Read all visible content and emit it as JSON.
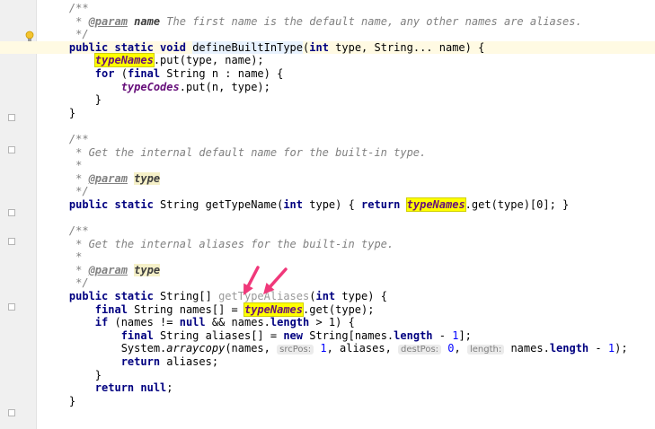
{
  "editor": {
    "lines": [
      [
        {
          "t": "    /**",
          "c": "c"
        }
      ],
      [
        {
          "t": "     * ",
          "c": "c"
        },
        {
          "t": "@param",
          "c": "tag"
        },
        {
          "t": " ",
          "c": "c"
        },
        {
          "t": "name",
          "c": "pname"
        },
        {
          "t": " The first name is the default name, any other names are aliases.",
          "c": "c"
        }
      ],
      [
        {
          "t": "     */",
          "c": "c"
        }
      ],
      [
        {
          "t": "    "
        },
        {
          "t": "public static void",
          "c": "k"
        },
        {
          "t": " "
        },
        {
          "t": "defineBuiltInType",
          "c": "m"
        },
        {
          "t": "("
        },
        {
          "t": "int",
          "c": "k"
        },
        {
          "t": " type, String... name) {"
        }
      ],
      [
        {
          "t": "        "
        },
        {
          "t": "typeNames",
          "c": "fld hl"
        },
        {
          "t": ".put(type, name);"
        }
      ],
      [
        {
          "t": "        "
        },
        {
          "t": "for",
          "c": "k"
        },
        {
          "t": " ("
        },
        {
          "t": "final",
          "c": "k"
        },
        {
          "t": " String n : name) {"
        }
      ],
      [
        {
          "t": "            "
        },
        {
          "t": "typeCodes",
          "c": "fld"
        },
        {
          "t": ".put(n, type);"
        }
      ],
      [
        {
          "t": "        }"
        }
      ],
      [
        {
          "t": "    }"
        }
      ],
      [
        {
          "t": ""
        }
      ],
      [
        {
          "t": "    /**",
          "c": "c"
        }
      ],
      [
        {
          "t": "     * Get the internal default name for the built-in type.",
          "c": "c"
        }
      ],
      [
        {
          "t": "     *",
          "c": "c"
        }
      ],
      [
        {
          "t": "     * ",
          "c": "c"
        },
        {
          "t": "@param",
          "c": "tag"
        },
        {
          "t": " ",
          "c": "c"
        },
        {
          "t": "type",
          "c": "pn"
        }
      ],
      [
        {
          "t": "     */",
          "c": "c"
        }
      ],
      [
        {
          "t": "    "
        },
        {
          "t": "public static",
          "c": "k"
        },
        {
          "t": " String getTypeName("
        },
        {
          "t": "int",
          "c": "k"
        },
        {
          "t": " type) { "
        },
        {
          "t": "return",
          "c": "k"
        },
        {
          "t": " "
        },
        {
          "t": "typeNames",
          "c": "fld hl"
        },
        {
          "t": ".get(type)[0]; }"
        }
      ],
      [
        {
          "t": ""
        }
      ],
      [
        {
          "t": "    /**",
          "c": "c"
        }
      ],
      [
        {
          "t": "     * Get the internal aliases for the built-in type.",
          "c": "c"
        }
      ],
      [
        {
          "t": "     *",
          "c": "c"
        }
      ],
      [
        {
          "t": "     * ",
          "c": "c"
        },
        {
          "t": "@param",
          "c": "tag"
        },
        {
          "t": " ",
          "c": "c"
        },
        {
          "t": "type",
          "c": "pn"
        }
      ],
      [
        {
          "t": "     */",
          "c": "c"
        }
      ],
      [
        {
          "t": "    "
        },
        {
          "t": "public static",
          "c": "k"
        },
        {
          "t": " String[] "
        },
        {
          "t": "getTypeAliases",
          "c": "unused"
        },
        {
          "t": "("
        },
        {
          "t": "int",
          "c": "k"
        },
        {
          "t": " type) {"
        }
      ],
      [
        {
          "t": "        "
        },
        {
          "t": "final",
          "c": "k"
        },
        {
          "t": " String names[] = "
        },
        {
          "t": "typeNames",
          "c": "fld hl"
        },
        {
          "t": ".get(type);"
        }
      ],
      [
        {
          "t": "        "
        },
        {
          "t": "if",
          "c": "k"
        },
        {
          "t": " (names != "
        },
        {
          "t": "null",
          "c": "k"
        },
        {
          "t": " && names."
        },
        {
          "t": "length",
          "c": "k"
        },
        {
          "t": " > 1) {"
        }
      ],
      [
        {
          "t": "            "
        },
        {
          "t": "final",
          "c": "k"
        },
        {
          "t": " String aliases[] = "
        },
        {
          "t": "new",
          "c": "k"
        },
        {
          "t": " String[names."
        },
        {
          "t": "length",
          "c": "k"
        },
        {
          "t": " - "
        },
        {
          "t": "1",
          "c": "num"
        },
        {
          "t": "];"
        }
      ],
      [
        {
          "t": "            System."
        },
        {
          "t": "arraycopy",
          "c": "st"
        },
        {
          "t": "(names, "
        },
        {
          "t": "srcPos:",
          "c": "hint"
        },
        {
          "t": " "
        },
        {
          "t": "1",
          "c": "num"
        },
        {
          "t": ", aliases, "
        },
        {
          "t": "destPos:",
          "c": "hint"
        },
        {
          "t": " "
        },
        {
          "t": "0",
          "c": "num"
        },
        {
          "t": ", "
        },
        {
          "t": "length:",
          "c": "hint"
        },
        {
          "t": " names."
        },
        {
          "t": "length",
          "c": "k"
        },
        {
          "t": " - "
        },
        {
          "t": "1",
          "c": "num"
        },
        {
          "t": ");"
        }
      ],
      [
        {
          "t": "            "
        },
        {
          "t": "return",
          "c": "k"
        },
        {
          "t": " aliases;"
        }
      ],
      [
        {
          "t": "        }"
        }
      ],
      [
        {
          "t": "        "
        },
        {
          "t": "return null",
          "c": "k"
        },
        {
          "t": ";"
        }
      ],
      [
        {
          "t": "    }"
        }
      ]
    ],
    "current_line": 3
  },
  "gutter": {
    "lamp_icon": "lightbulb-icon",
    "fold_icon": "fold-marker-icon"
  },
  "annotation": {
    "arrow_color": "#f0387a",
    "arrow_icon": "arrow-icon"
  }
}
